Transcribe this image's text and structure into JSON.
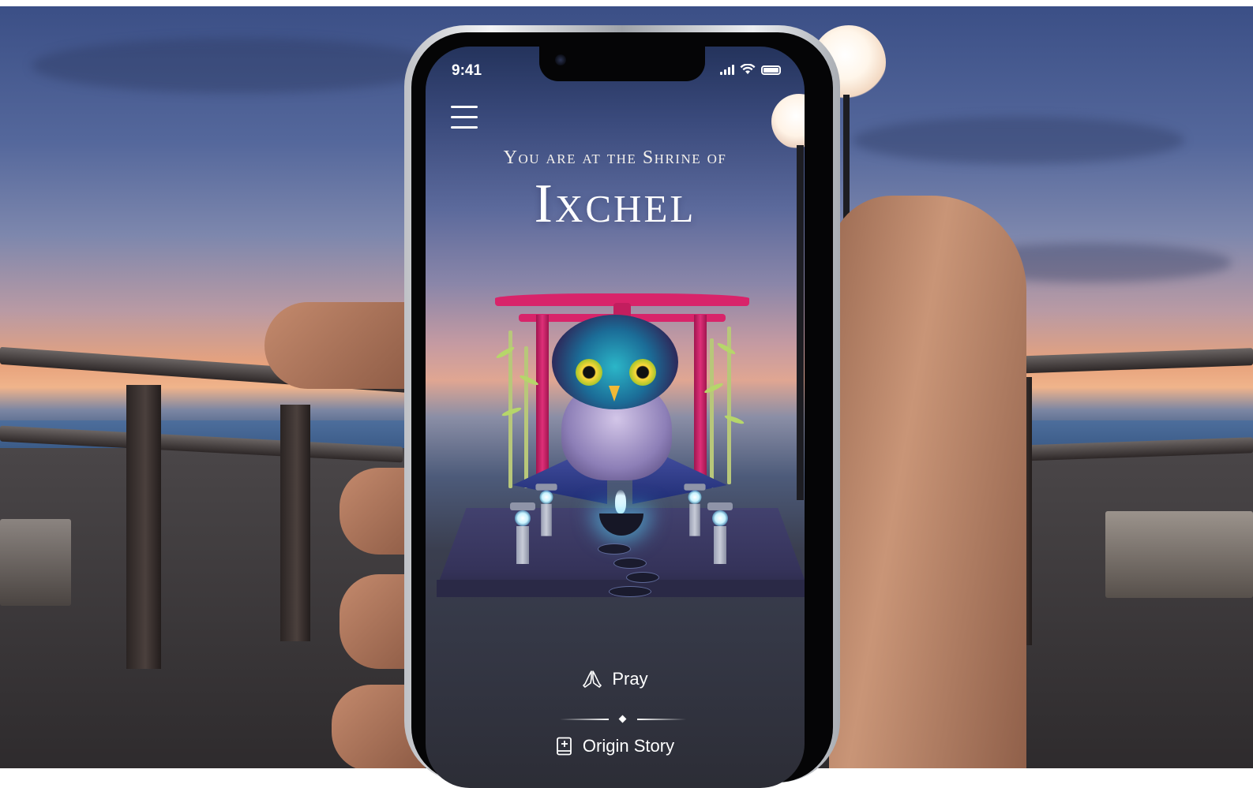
{
  "status_bar": {
    "time": "9:41",
    "icons": [
      "cellular-signal-icon",
      "wifi-icon",
      "battery-icon"
    ]
  },
  "header": {
    "menu_icon": "hamburger-menu-icon",
    "title_prefix": "You are at the Shrine of",
    "title_name": "Ixchel"
  },
  "actions": {
    "pray": {
      "label": "Pray",
      "icon": "praying-hands-icon"
    },
    "origin_story": {
      "label": "Origin Story",
      "icon": "book-icon"
    }
  },
  "colors": {
    "torii": "#d8246a",
    "text": "#ffffff",
    "glow": "#8fe8ff"
  }
}
